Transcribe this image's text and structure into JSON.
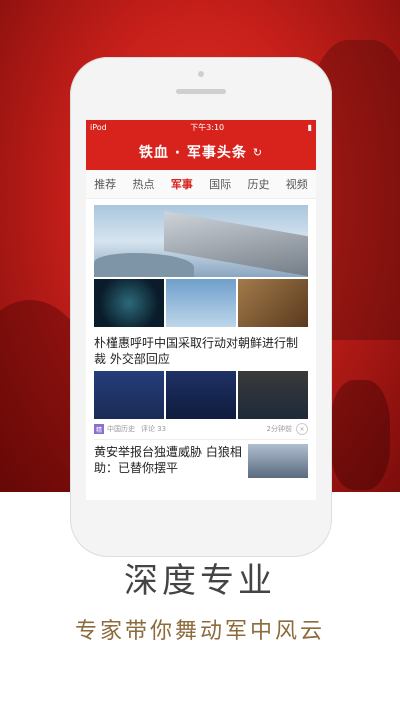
{
  "status_bar": {
    "carrier": "iPod",
    "time": "下午3:10"
  },
  "app": {
    "title": "铁血 · 军事头条",
    "refresh_icon": "refresh-icon"
  },
  "tabs": [
    {
      "label": "推荐"
    },
    {
      "label": "热点"
    },
    {
      "label": "军事",
      "active": true
    },
    {
      "label": "国际"
    },
    {
      "label": "历史"
    },
    {
      "label": "视频"
    }
  ],
  "feed": {
    "article1": {
      "title": "朴槿惠呼吁中国采取行动对朝鲜进行制裁 外交部回应"
    },
    "article1_meta": {
      "badge": "精",
      "source": "中国历史",
      "comments": "评论 33",
      "time": "2分钟前"
    },
    "article2": {
      "title": "黄安举报台独遭威胁 白狼相助：已替你摆平"
    }
  },
  "tagline": {
    "main": "深度专业",
    "sub": "专家带你舞动军中风云"
  },
  "colors": {
    "brand_red": "#d8221c",
    "tagline_gold": "#8c6b3d"
  }
}
